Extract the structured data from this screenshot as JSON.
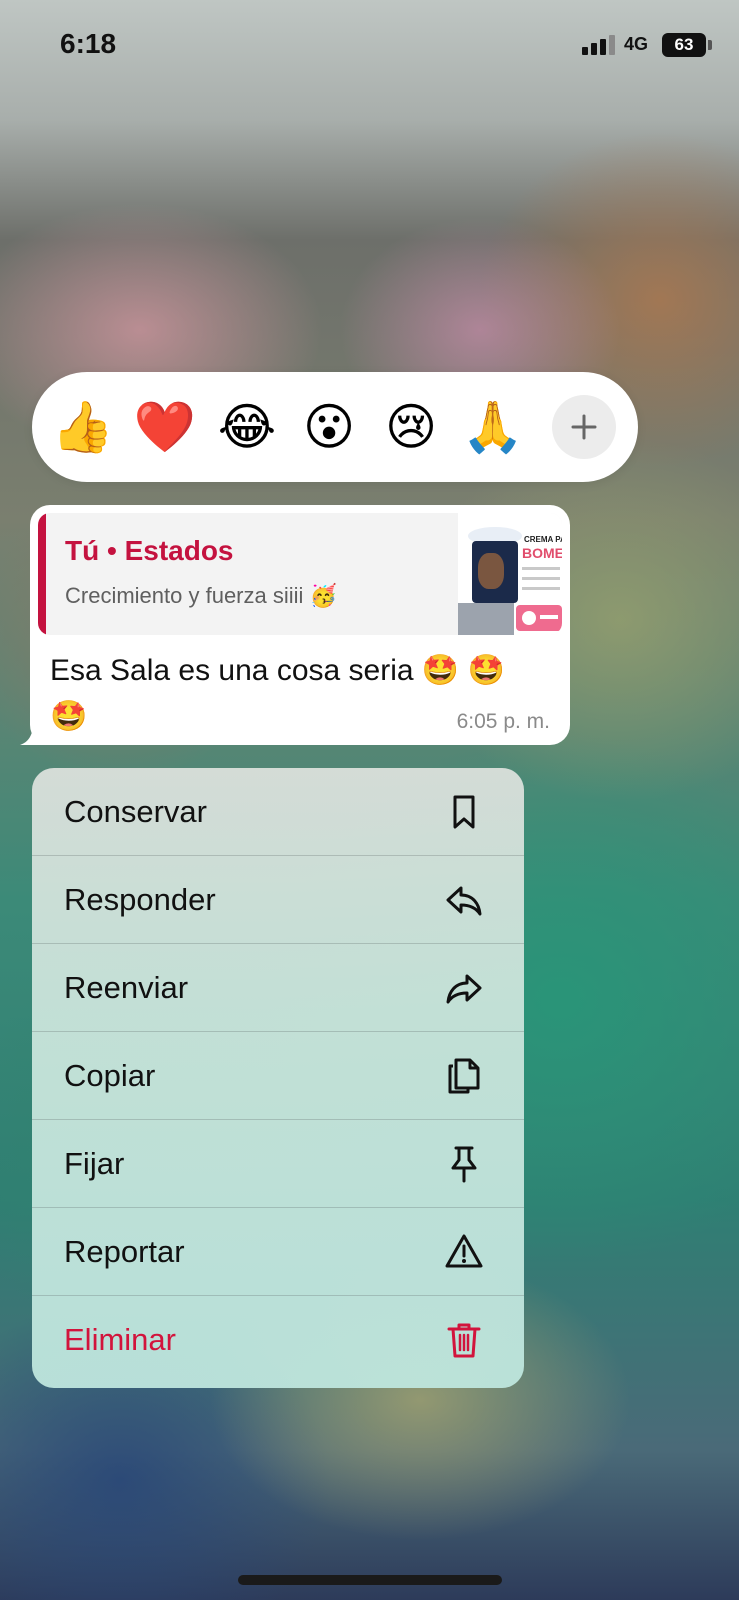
{
  "status_bar": {
    "time": "6:18",
    "network": "4G",
    "battery": "63"
  },
  "reactions": {
    "items": [
      {
        "name": "thumbs-up",
        "glyph": "👍"
      },
      {
        "name": "red-heart",
        "glyph": "❤️"
      },
      {
        "name": "face-with-tears-of-joy",
        "glyph": "😂"
      },
      {
        "name": "face-with-open-mouth",
        "glyph": "😮"
      },
      {
        "name": "crying-face",
        "glyph": "😢"
      },
      {
        "name": "folded-hands",
        "glyph": "🙏"
      }
    ],
    "add_icon": "plus-icon"
  },
  "message": {
    "quote_author": "Tú • Estados",
    "quote_text": "Crecimiento y fuerza siiii",
    "quote_emoji": "🥳",
    "thumbnail_heading_small": "CREMA PARA",
    "thumbnail_heading": "BOME",
    "text": "Esa Sala es una cosa seria",
    "text_emojis": [
      "🤩",
      "🤩",
      "🤩"
    ],
    "time": "6:05 p. m."
  },
  "menu": {
    "items": [
      {
        "label": "Conservar",
        "icon": "bookmark-icon",
        "danger": false
      },
      {
        "label": "Responder",
        "icon": "reply-icon",
        "danger": false
      },
      {
        "label": "Reenviar",
        "icon": "forward-icon",
        "danger": false
      },
      {
        "label": "Copiar",
        "icon": "copy-icon",
        "danger": false
      },
      {
        "label": "Fijar",
        "icon": "pin-icon",
        "danger": false
      },
      {
        "label": "Reportar",
        "icon": "warning-icon",
        "danger": false
      },
      {
        "label": "Eliminar",
        "icon": "trash-icon",
        "danger": true
      }
    ]
  },
  "colors": {
    "accent": "#c4123f",
    "danger": "#d2143c",
    "bubble": "#ffffff",
    "timestamp": "#8a8a8a"
  }
}
